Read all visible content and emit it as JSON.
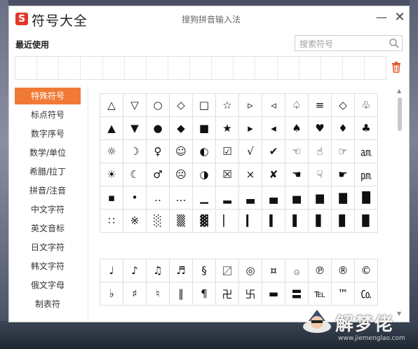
{
  "window": {
    "logo_letter": "S",
    "title": "符号大全",
    "ime_name": "搜狗拼音输入法",
    "minimize_glyph": "—",
    "close_glyph": "✕"
  },
  "recent": {
    "label": "最近使用",
    "cell_count": 17
  },
  "search": {
    "placeholder": "搜索符号",
    "value": ""
  },
  "sidebar": {
    "items": [
      {
        "label": "特殊符号",
        "active": true
      },
      {
        "label": "标点符号"
      },
      {
        "label": "数字序号"
      },
      {
        "label": "数学/单位"
      },
      {
        "label": "希腊/拉丁"
      },
      {
        "label": "拼音/注音"
      },
      {
        "label": "中文字符"
      },
      {
        "label": "英文音标"
      },
      {
        "label": "日文字符"
      },
      {
        "label": "韩文字符"
      },
      {
        "label": "俄文字母"
      },
      {
        "label": "制表符"
      }
    ]
  },
  "symbols_group1": [
    [
      "△",
      "▽",
      "○",
      "◇",
      "□",
      "☆",
      "▹",
      "◃",
      "♤",
      "≡",
      "◇",
      "♧"
    ],
    [
      "▲",
      "▼",
      "●",
      "◆",
      "■",
      "★",
      "▸",
      "◂",
      "♠",
      "♥",
      "♦",
      "♣"
    ],
    [
      "☼",
      "☽",
      "♀",
      "☺",
      "◐",
      "☑",
      "√",
      "✔",
      "☜",
      "☝",
      "☞",
      "㏂"
    ],
    [
      "☀",
      "☾",
      "♂",
      "☹",
      "◑",
      "☒",
      "×",
      "✘",
      "☚",
      "☟",
      "☛",
      "㏘"
    ],
    [
      "▪",
      "•",
      "‥",
      "…",
      "▁",
      "▂",
      "▃",
      "▄",
      "▅",
      "▆",
      "▇",
      "█"
    ],
    [
      "∷",
      "※",
      "░",
      "▒",
      "▓",
      "▏",
      "▎",
      "▍",
      "▌",
      "▋",
      "▊",
      "▉"
    ]
  ],
  "symbols_group2": [
    [
      "♩",
      "♪",
      "♫",
      "♬",
      "§",
      "〼",
      "◎",
      "¤",
      "۞",
      "℗",
      "®",
      "©"
    ],
    [
      "♭",
      "♯",
      "♮",
      "‖",
      "¶",
      "卍",
      "卐",
      "▬",
      "〓",
      "℡",
      "™",
      "㏇"
    ]
  ],
  "watermark": {
    "text": "解梦佬",
    "url": "www.jiemenglao.com"
  }
}
